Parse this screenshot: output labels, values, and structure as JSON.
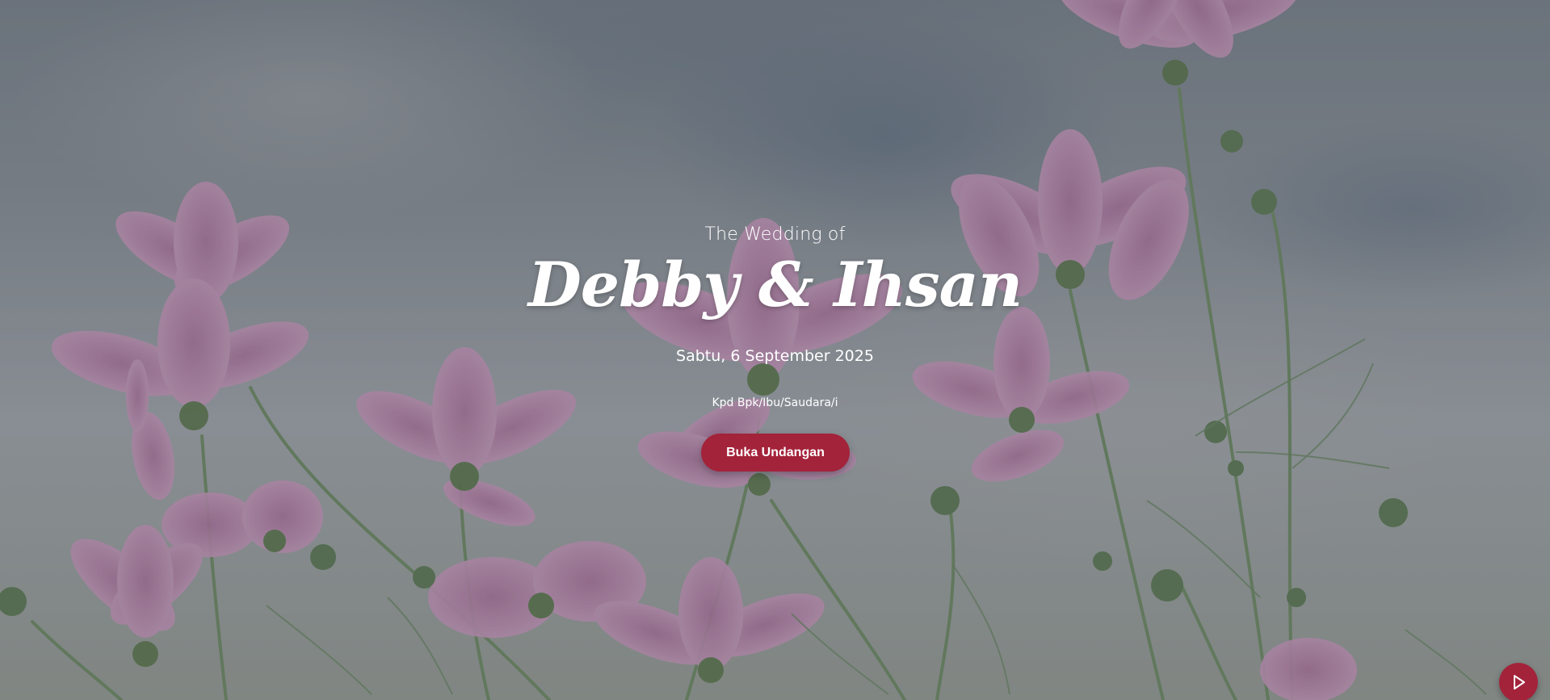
{
  "hero": {
    "subtitle": "The Wedding of",
    "couple_names": "Debby & Ihsan",
    "date": "Sabtu, 6 September 2025",
    "guest_label": "Kpd Bpk/Ibu/Saudara/i",
    "open_button_label": "Buka Undangan"
  },
  "icons": {
    "music_toggle": "play-icon"
  },
  "colors": {
    "accent": "#a3233a",
    "text": "#ffffff",
    "flower_petal": "#c58bbd",
    "stem": "#5f7f5a"
  }
}
